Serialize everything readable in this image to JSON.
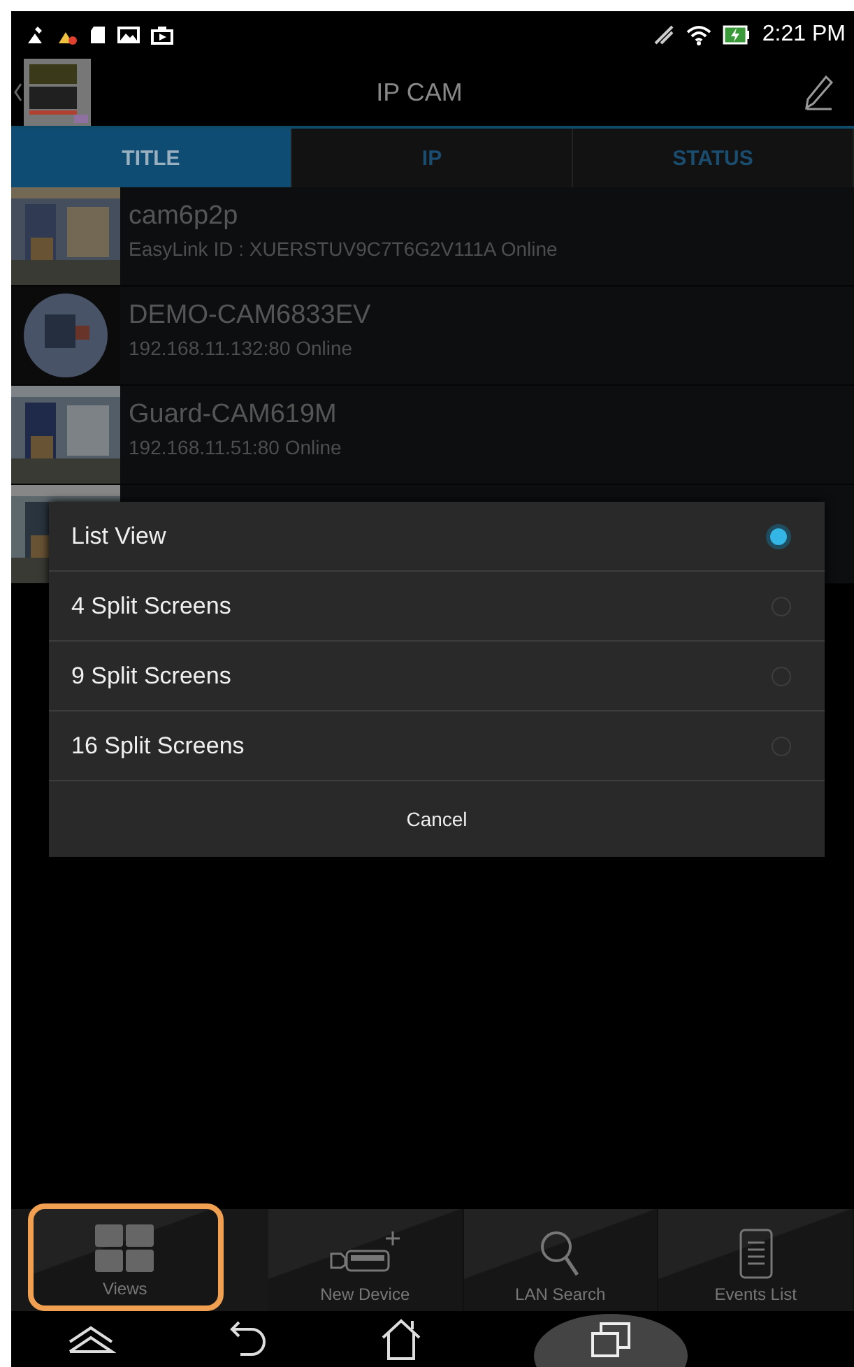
{
  "status_bar": {
    "time": "2:21 PM"
  },
  "header": {
    "title": "IP CAM"
  },
  "tabs": [
    {
      "label": "TITLE",
      "selected": true
    },
    {
      "label": "IP",
      "selected": false
    },
    {
      "label": "STATUS",
      "selected": false
    }
  ],
  "cameras": [
    {
      "name": "cam6p2p",
      "detail": "EasyLink ID : XUERSTUV9C7T6G2V111A  Online",
      "thumbnail": {
        "kind": "picture"
      }
    },
    {
      "name": "DEMO-CAM6833EV",
      "detail": "192.168.11.132:80  Online",
      "thumbnail": {
        "kind": "picture"
      }
    },
    {
      "name": "Guard-CAM619M",
      "detail": "192.168.11.51:80  Online",
      "thumbnail": {
        "kind": "picture"
      }
    },
    {
      "thumbnail": {
        "kind": "picture"
      }
    }
  ],
  "dialog": {
    "options": [
      {
        "label": "List View",
        "selected": true
      },
      {
        "label": "4 Split Screens",
        "selected": false
      },
      {
        "label": "9 Split Screens",
        "selected": false
      },
      {
        "label": "16 Split Screens",
        "selected": false
      }
    ],
    "cancel": "Cancel"
  },
  "toolbar": [
    {
      "label": "Views",
      "kind": "views",
      "highlighted": true
    },
    {
      "label": "New Device",
      "kind": "add",
      "highlighted": false
    },
    {
      "label": "LAN Search",
      "kind": "search",
      "highlighted": false
    },
    {
      "label": "Events List",
      "kind": "events",
      "highlighted": false
    }
  ]
}
